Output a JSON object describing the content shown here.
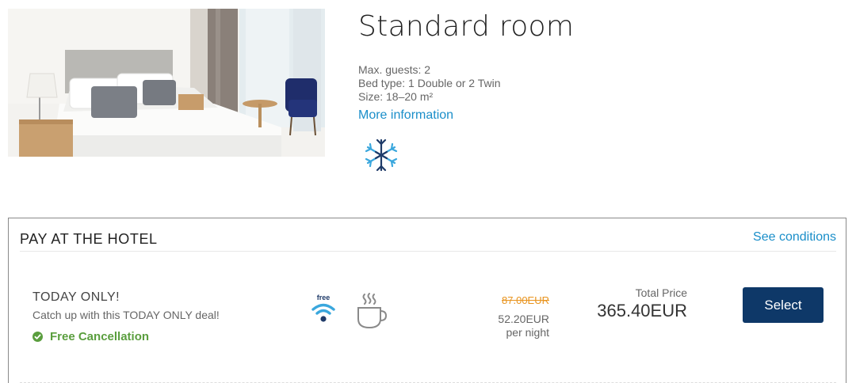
{
  "room": {
    "title": "Standard room",
    "max_guests": "Max. guests: 2",
    "bed_type": "Bed type: 1 Double or 2 Twin",
    "size": "Size: 18–20 m²",
    "more_info_label": "More information",
    "photo_alt": "Standard room photo",
    "amenity_icon": "snowflake-icon"
  },
  "rate": {
    "title": "PAY AT THE HOTEL",
    "conditions_label": "See conditions",
    "offer_name": "TODAY ONLY!",
    "offer_description": "Catch up with this TODAY ONLY deal!",
    "cancellation": "Free Cancellation",
    "wifi_label": "free",
    "old_price": "87.00EUR",
    "night_price": "52.20EUR",
    "per_night": "per night",
    "total_label": "Total Price",
    "total_price": "365.40EUR",
    "select_label": "Select"
  },
  "colors": {
    "link": "#1a8ec9",
    "button": "#0e3868",
    "old_price": "#e8931d",
    "cancellation": "#5a9e3e",
    "snowflake_dark": "#1f3b69",
    "snowflake_light": "#3aa7dd"
  }
}
